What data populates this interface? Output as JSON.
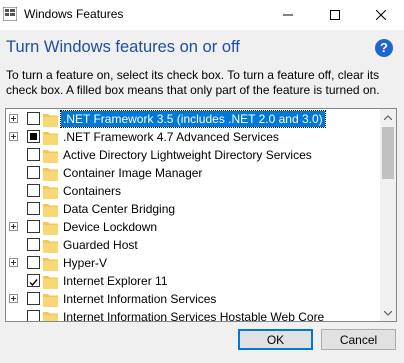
{
  "window": {
    "title": "Windows Features",
    "controls": [
      "minimize",
      "maximize",
      "close"
    ]
  },
  "header": {
    "heading": "Turn Windows features on or off",
    "description": "To turn a feature on, select its check box. To turn a feature off, clear its check box. A filled box means that only part of the feature is turned on."
  },
  "features": [
    {
      "label": ".NET Framework 3.5 (includes .NET 2.0 and 3.0)",
      "state": "unchecked",
      "expandable": true,
      "selected": true
    },
    {
      "label": ".NET Framework 4.7 Advanced Services",
      "state": "partial",
      "expandable": true,
      "selected": false
    },
    {
      "label": "Active Directory Lightweight Directory Services",
      "state": "unchecked",
      "expandable": false,
      "selected": false
    },
    {
      "label": "Container Image Manager",
      "state": "unchecked",
      "expandable": false,
      "selected": false
    },
    {
      "label": "Containers",
      "state": "unchecked",
      "expandable": false,
      "selected": false
    },
    {
      "label": "Data Center Bridging",
      "state": "unchecked",
      "expandable": false,
      "selected": false
    },
    {
      "label": "Device Lockdown",
      "state": "unchecked",
      "expandable": true,
      "selected": false
    },
    {
      "label": "Guarded Host",
      "state": "unchecked",
      "expandable": false,
      "selected": false
    },
    {
      "label": "Hyper-V",
      "state": "unchecked",
      "expandable": true,
      "selected": false
    },
    {
      "label": "Internet Explorer 11",
      "state": "checked",
      "expandable": false,
      "selected": false
    },
    {
      "label": "Internet Information Services",
      "state": "unchecked",
      "expandable": true,
      "selected": false
    },
    {
      "label": "Internet Information Services Hostable Web Core",
      "state": "unchecked",
      "expandable": false,
      "selected": false
    }
  ],
  "buttons": {
    "ok": "OK",
    "cancel": "Cancel"
  },
  "colors": {
    "accent": "#0078d7",
    "heading": "#1f4ea0",
    "folder": "#f2c755",
    "help": "#1e64d2"
  }
}
